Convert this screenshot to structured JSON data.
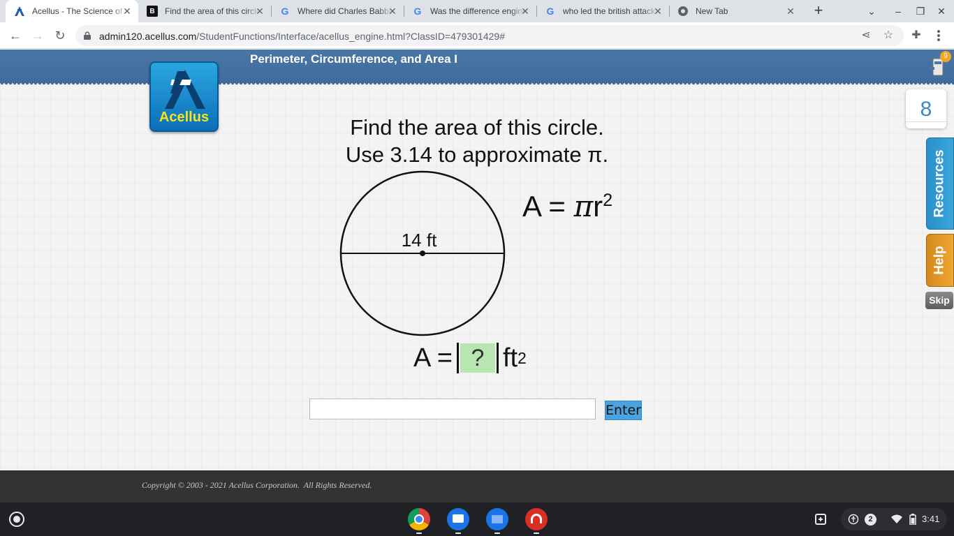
{
  "browser": {
    "tabs": [
      {
        "title": "Acellus - The Science of Learning",
        "favicon": "acellus-icon",
        "active": true
      },
      {
        "title": "Find the area of this circle",
        "favicon": "brainly-icon",
        "active": false
      },
      {
        "title": "Where did Charles Babbage",
        "favicon": "google-icon",
        "active": false
      },
      {
        "title": "Was the difference engine",
        "favicon": "google-icon",
        "active": false
      },
      {
        "title": "who led the british attack",
        "favicon": "google-icon",
        "active": false
      },
      {
        "title": "New Tab",
        "favicon": "chrome-icon",
        "active": false
      }
    ],
    "url_host": "admin120.acellus.com",
    "url_path": "/StudentFunctions/Interface/acellus_engine.html?ClassID=479301429#"
  },
  "page": {
    "lesson_title": "Perimeter, Circumference, and Area I",
    "logo_text": "Acellus",
    "notification_count": "9",
    "problem_counter": "8",
    "resources_label": "Resources",
    "help_label": "Help",
    "skip_label": "Skip",
    "question_line1": "Find the area of this circle.",
    "question_line2": "Use 3.14 to approximate π.",
    "diameter_label": "14 ft",
    "formula_lhs": "A = ",
    "formula_pi": "π",
    "formula_r": "r",
    "formula_exp": "2",
    "answer_lhs": "A =",
    "answer_placeholder": "?",
    "answer_unit": "ft",
    "answer_exp": "2",
    "answer_input_value": "",
    "enter_label": "Enter",
    "copyright": "Copyright © 2003 - 2021 Acellus Corporation.  All Rights Reserved."
  },
  "shelf": {
    "apps": [
      "chrome-icon",
      "messages-icon",
      "files-icon",
      "music-icon"
    ],
    "notification_count": "2",
    "time": "3:41"
  },
  "colors": {
    "banner": "#4a76a6",
    "resources_tab": "#2a8fc9",
    "help_tab": "#f0a733",
    "enter_button": "#4aa3df",
    "answer_fill": "#b7e6b0"
  }
}
